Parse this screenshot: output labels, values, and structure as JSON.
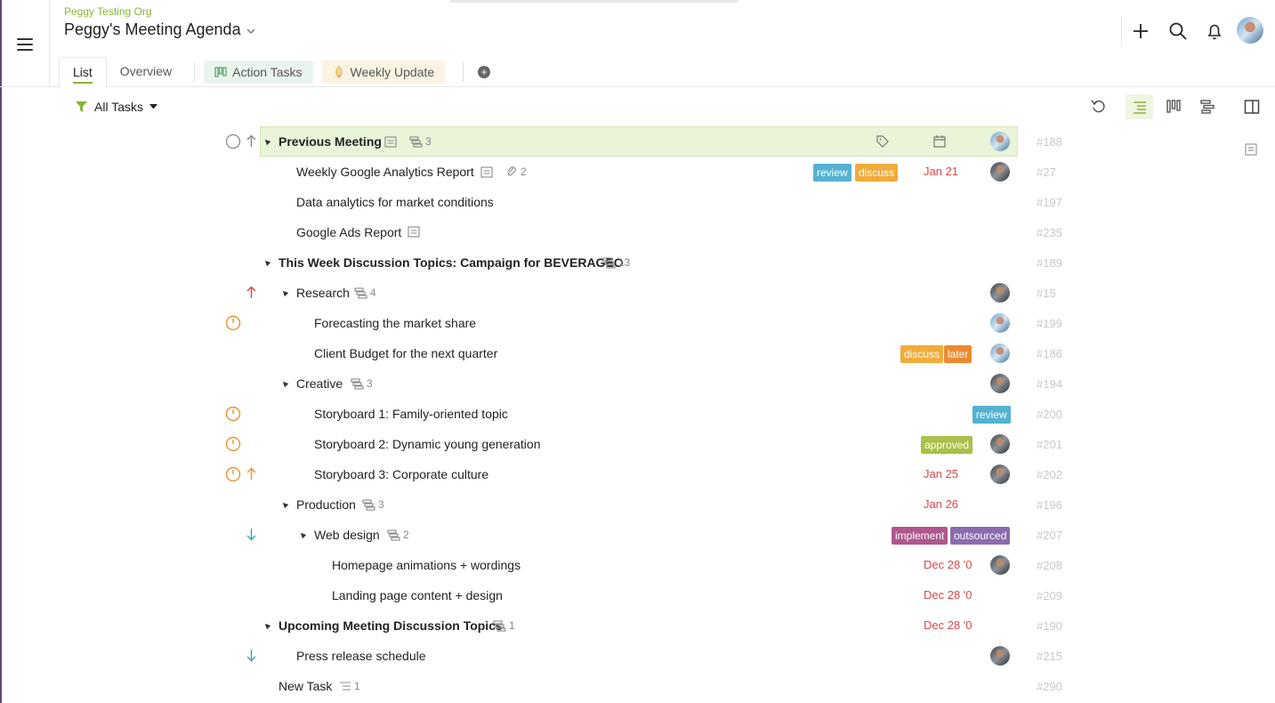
{
  "header": {
    "org": "Peggy Testing Org",
    "title": "Peggy's Meeting Agenda",
    "tabs": [
      {
        "label": "List"
      },
      {
        "label": "Overview"
      },
      {
        "label": "Action Tasks"
      },
      {
        "label": "Weekly Update"
      }
    ]
  },
  "toolbar": {
    "filter_label": "All Tasks"
  },
  "colors": {
    "accent": "#8bb33a",
    "date_red": "#e0464a",
    "highlight": "#e9f4d8"
  },
  "tasks": [
    {
      "name": "Previous Meeting",
      "num": "#188",
      "count": "3"
    },
    {
      "name": "Weekly Google Analytics Report",
      "num": "#27",
      "count": "2",
      "tags": [
        "review",
        "discuss"
      ],
      "date": "Jan 21"
    },
    {
      "name": "Data analytics for market conditions",
      "num": "#197"
    },
    {
      "name": "Google Ads Report",
      "num": "#235"
    },
    {
      "name": "This Week Discussion Topics: Campaign for BEVERAGEO",
      "num": "#189",
      "count": "13"
    },
    {
      "name": "Research",
      "num": "#15",
      "count": "4"
    },
    {
      "name": "Forecasting the market share",
      "num": "#199"
    },
    {
      "name": "Client Budget for the next quarter",
      "num": "#186",
      "tags": [
        "discuss",
        "later"
      ]
    },
    {
      "name": "Creative",
      "num": "#194",
      "count": "3"
    },
    {
      "name": "Storyboard 1: Family-oriented topic",
      "num": "#200",
      "tags": [
        "review"
      ]
    },
    {
      "name": "Storyboard 2: Dynamic young generation",
      "num": "#201",
      "tags": [
        "approved"
      ]
    },
    {
      "name": "Storyboard 3: Corporate culture",
      "num": "#202",
      "date": "Jan 25"
    },
    {
      "name": "Production",
      "num": "#196",
      "count": "3",
      "date": "Jan 26"
    },
    {
      "name": "Web design",
      "num": "#207",
      "count": "2",
      "tags": [
        "implement",
        "outsourced"
      ]
    },
    {
      "name": "Homepage animations + wordings",
      "num": "#208",
      "date": "Dec 28 '0"
    },
    {
      "name": "Landing page content + design",
      "num": "#209",
      "date": "Dec 28 '0"
    },
    {
      "name": "Upcoming Meeting Discussion Topics",
      "num": "#190",
      "count": "1",
      "date": "Dec 28 '0"
    },
    {
      "name": "Press release schedule",
      "num": "#215"
    },
    {
      "name": "New Task",
      "num": "#290",
      "count": "1"
    }
  ]
}
